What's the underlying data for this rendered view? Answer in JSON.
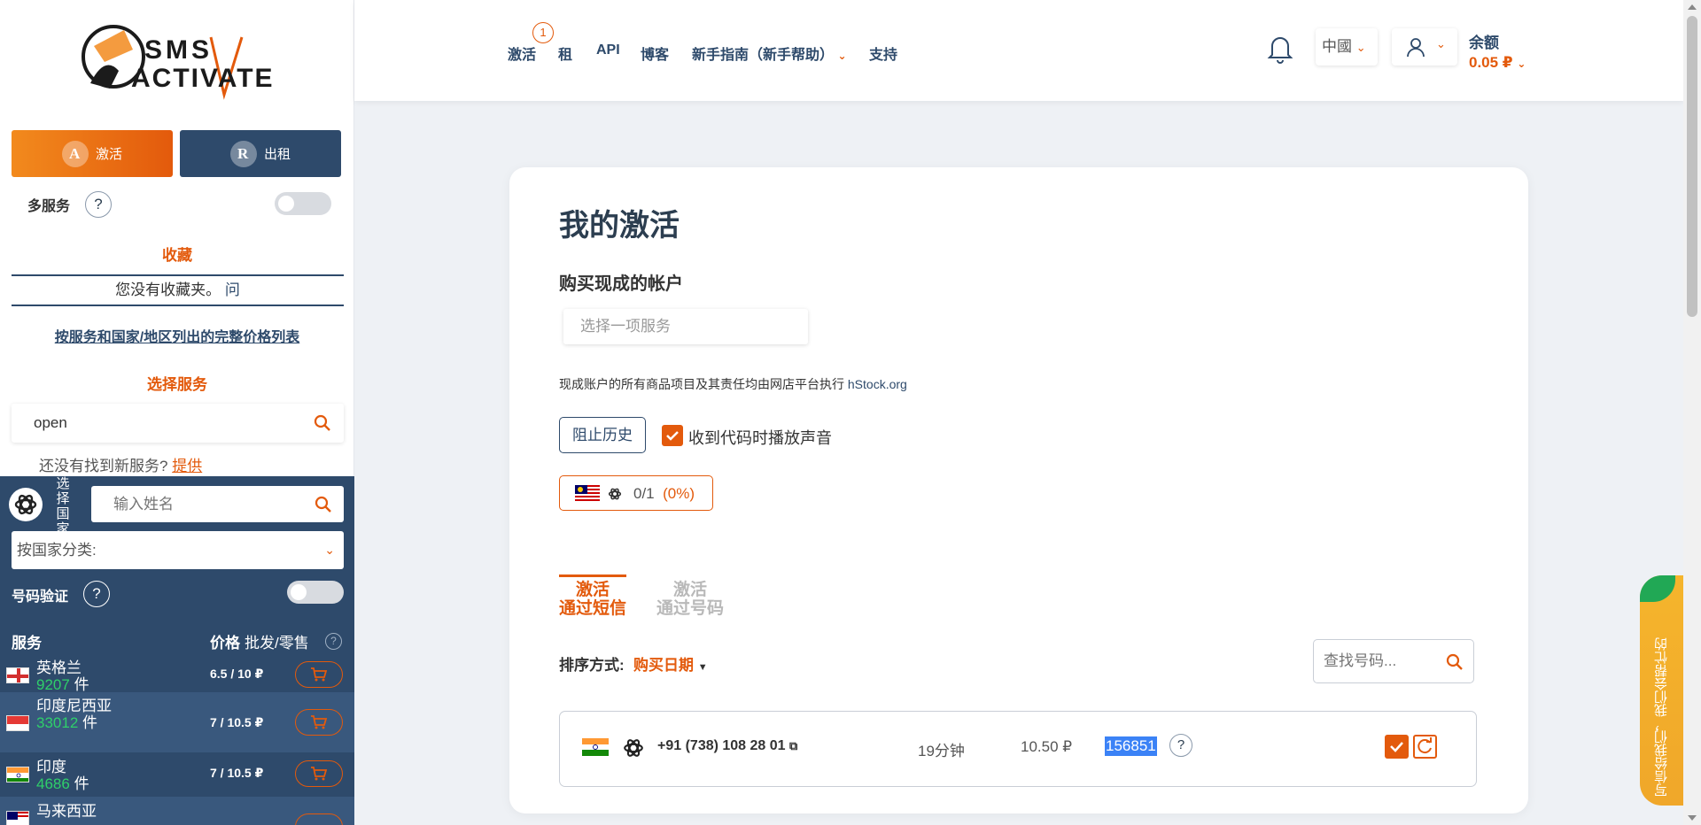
{
  "sidebar": {
    "logo_text_line1": "SMS",
    "logo_text_line2": "ACTIVATE",
    "mode_activate": "激活",
    "mode_rent": "出租",
    "multi_service": "多服务",
    "favorites_title": "收藏",
    "favorites_empty": "您没有收藏夹。",
    "favorites_q": "问",
    "price_list_link": "按服务和国家/地区列出的完整价格列表",
    "select_service": "选择服务",
    "service_search_value": "open",
    "not_found_text": "还没有找到新服务?",
    "not_found_link": "提供",
    "select_country": "选择国家",
    "country_search_placeholder": "输入姓名",
    "country_category": "按国家分类:",
    "number_verification": "号码验证",
    "table_header_service": "服务",
    "table_header_price": "价格",
    "table_header_wholesale": "批发/零售",
    "countries": [
      {
        "name": "英格兰",
        "count": "9207",
        "unit": "件",
        "price": "6.5 / 10 ₽"
      },
      {
        "name": "印度尼西亚",
        "count": "33012",
        "unit": "件",
        "price": "7 / 10.5 ₽"
      },
      {
        "name": "印度",
        "count": "4686",
        "unit": "件",
        "price": "7 / 10.5 ₽"
      },
      {
        "name": "马来西亚",
        "count": "",
        "unit": "",
        "price": ""
      }
    ]
  },
  "topbar": {
    "nav": [
      "激活",
      "租",
      "API",
      "博客",
      "新手指南（新手帮助）",
      "支持"
    ],
    "badge": "1",
    "lang": "中國",
    "balance_label": "余额",
    "balance_value": "0.05 ₽"
  },
  "main": {
    "title": "我的激活",
    "buy_accounts": "购买现成的帐户",
    "service_select_placeholder": "选择一项服务",
    "disclaimer": "现成账户的所有商品项目及其责任均由网店平台执行",
    "disclaimer_link": "hStock.org",
    "block_history": "阻止历史",
    "play_sound": "收到代码时播放声音",
    "stat_count": "0/1",
    "stat_pct": "(0%)",
    "tab_sms_line1": "激活",
    "tab_sms_line2": "通过短信",
    "tab_number_line1": "激活",
    "tab_number_line2": "通过号码",
    "sort_label": "排序方式:",
    "sort_value": "购买日期",
    "number_search_placeholder": "查找号码...",
    "activation": {
      "phone": "+91 (738) 108 28 01",
      "time": "19分钟",
      "price": "10.50 ₽",
      "code": "156851"
    }
  },
  "feedback_text": "写信给我们，我们会帮忙的",
  "colors": {
    "accent": "#e35a0c",
    "navy": "#2e4a6b",
    "green": "#2fcf6a"
  }
}
